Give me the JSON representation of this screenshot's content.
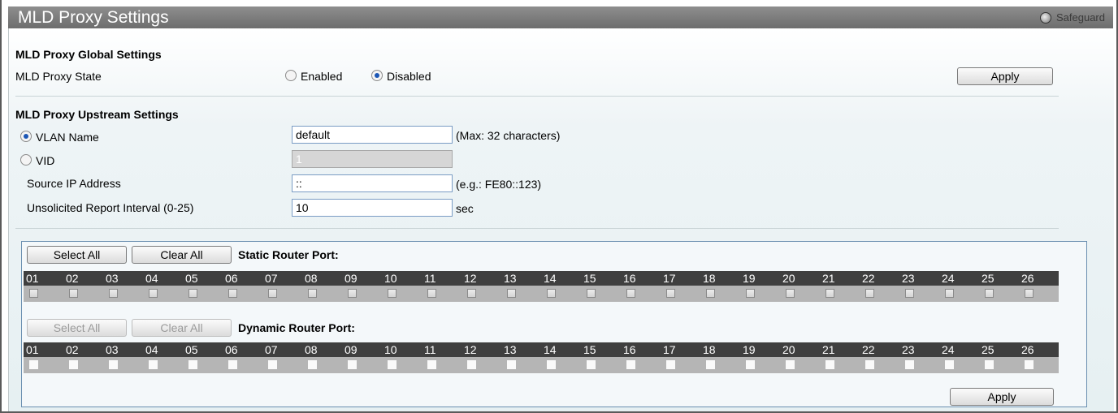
{
  "header": {
    "title": "MLD Proxy Settings",
    "safeguard_label": "Safeguard"
  },
  "global": {
    "section_title": "MLD Proxy Global Settings",
    "state_label": "MLD Proxy State",
    "enabled_label": "Enabled",
    "disabled_label": "Disabled",
    "selected": "Disabled",
    "apply_label": "Apply"
  },
  "upstream": {
    "section_title": "MLD Proxy Upstream Settings",
    "vlan_name_label": "VLAN Name",
    "vlan_name_value": "default",
    "vlan_name_hint": "(Max: 32 characters)",
    "vid_label": "VID",
    "vid_value": "1",
    "selected": "VLAN Name",
    "source_ip_label": "Source IP Address",
    "source_ip_value": "::",
    "source_ip_hint": "(e.g.: FE80::123)",
    "interval_label": "Unsolicited Report Interval (0-25)",
    "interval_value": "10",
    "interval_unit": "sec"
  },
  "static_ports": {
    "select_all_label": "Select All",
    "clear_all_label": "Clear All",
    "title": "Static Router Port:",
    "ports": [
      "01",
      "02",
      "03",
      "04",
      "05",
      "06",
      "07",
      "08",
      "09",
      "10",
      "11",
      "12",
      "13",
      "14",
      "15",
      "16",
      "17",
      "18",
      "19",
      "20",
      "21",
      "22",
      "23",
      "24",
      "25",
      "26"
    ]
  },
  "dynamic_ports": {
    "select_all_label": "Select All",
    "clear_all_label": "Clear All",
    "title": "Dynamic Router Port:",
    "ports": [
      "01",
      "02",
      "03",
      "04",
      "05",
      "06",
      "07",
      "08",
      "09",
      "10",
      "11",
      "12",
      "13",
      "14",
      "15",
      "16",
      "17",
      "18",
      "19",
      "20",
      "21",
      "22",
      "23",
      "24",
      "25",
      "26"
    ]
  },
  "footer": {
    "apply_label": "Apply"
  }
}
